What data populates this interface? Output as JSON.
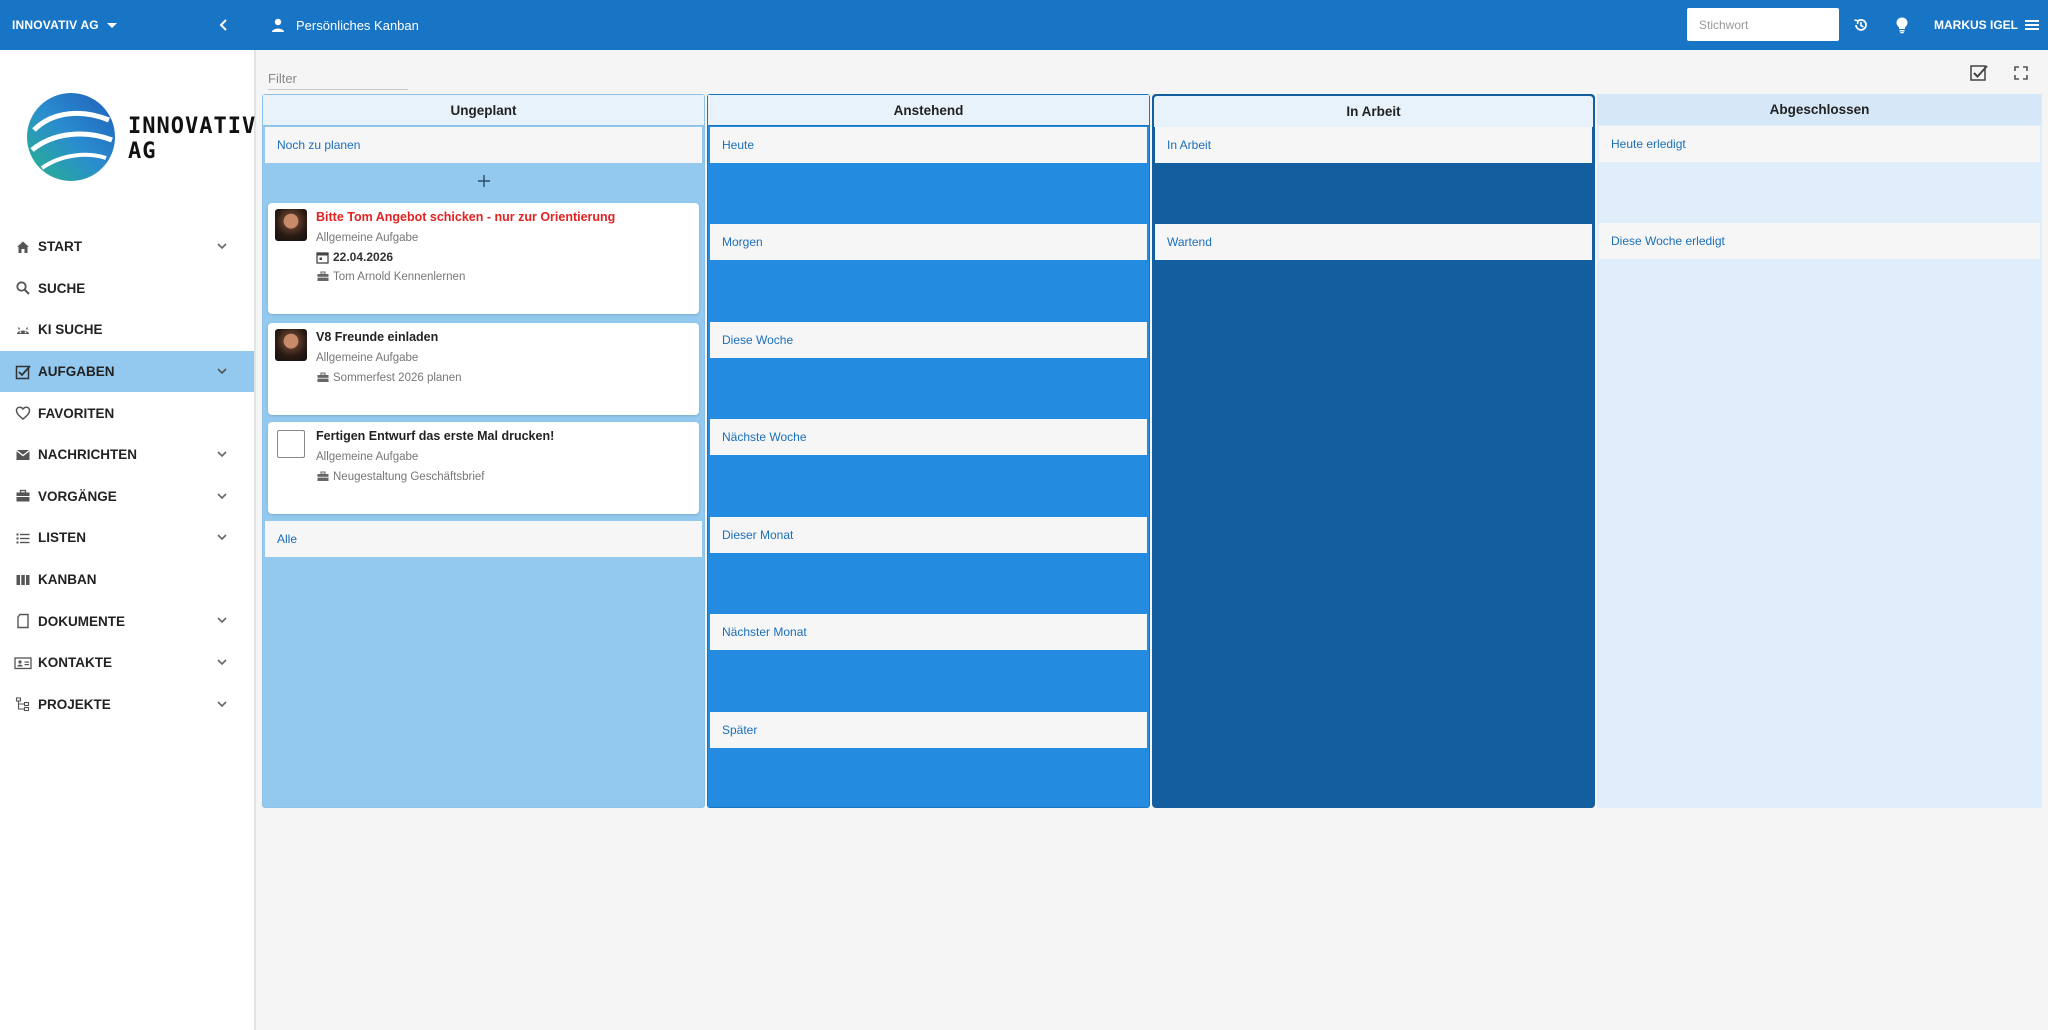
{
  "topbar": {
    "company": "INNOVATIV AG",
    "page_title": "Persönliches Kanban",
    "search_placeholder": "Stichwort",
    "user_name": "MARKUS IGEL"
  },
  "sidebar": {
    "logo_text_line1": "INNOVATIV",
    "logo_text_line2": "AG",
    "items": [
      {
        "label": "START",
        "icon": "home-icon",
        "has_chevron": true
      },
      {
        "label": "SUCHE",
        "icon": "search-icon",
        "has_chevron": false
      },
      {
        "label": "KI SUCHE",
        "icon": "robot-icon",
        "has_chevron": false
      },
      {
        "label": "AUFGABEN",
        "icon": "checkbox-icon",
        "has_chevron": true,
        "active": true
      },
      {
        "label": "FAVORITEN",
        "icon": "heart-icon",
        "has_chevron": false
      },
      {
        "label": "NACHRICHTEN",
        "icon": "mail-icon",
        "has_chevron": true
      },
      {
        "label": "VORGÄNGE",
        "icon": "briefcase-icon",
        "has_chevron": true
      },
      {
        "label": "LISTEN",
        "icon": "list-icon",
        "has_chevron": true
      },
      {
        "label": "KANBAN",
        "icon": "kanban-icon",
        "has_chevron": false
      },
      {
        "label": "DOKUMENTE",
        "icon": "document-icon",
        "has_chevron": true
      },
      {
        "label": "KONTAKTE",
        "icon": "contact-card-icon",
        "has_chevron": true
      },
      {
        "label": "PROJEKTE",
        "icon": "project-tree-icon",
        "has_chevron": true
      }
    ]
  },
  "main": {
    "filter_placeholder": "Filter"
  },
  "board": {
    "columns": [
      {
        "title": "Ungeplant",
        "sections": [
          "Noch zu planen",
          "Alle"
        ],
        "cards": [
          {
            "title": "Bitte Tom Angebot schicken - nur zur Orientierung",
            "urgent": true,
            "type": "Allgemeine Aufgabe",
            "date": "22.04.2026",
            "project": "Tom Arnold Kennenlernen"
          },
          {
            "title": "V8 Freunde einladen",
            "urgent": false,
            "type": "Allgemeine Aufgabe",
            "project": "Sommerfest 2026 planen"
          },
          {
            "title": "Fertigen Entwurf das erste Mal drucken!",
            "urgent": false,
            "type": "Allgemeine Aufgabe",
            "project": "Neugestaltung Geschäftsbrief"
          }
        ]
      },
      {
        "title": "Anstehend",
        "sections": [
          "Heute",
          "Morgen",
          "Diese Woche",
          "Nächste Woche",
          "Dieser Monat",
          "Nächster Monat",
          "Später"
        ]
      },
      {
        "title": "In Arbeit",
        "sections": [
          "In Arbeit",
          "Wartend"
        ]
      },
      {
        "title": "Abgeschlossen",
        "sections": [
          "Heute erledigt",
          "Diese Woche erledigt"
        ]
      }
    ]
  },
  "colors": {
    "topbar": "#1874c4",
    "active_nav": "#93c9ef",
    "col_ungeplant": "#93c9ef",
    "col_anstehend": "#248ce0",
    "col_inarbeit": "#125e9f",
    "col_abgeschlossen": "#e0eefb",
    "urgent_text": "#e32222",
    "section_link": "#1a6fbb"
  }
}
